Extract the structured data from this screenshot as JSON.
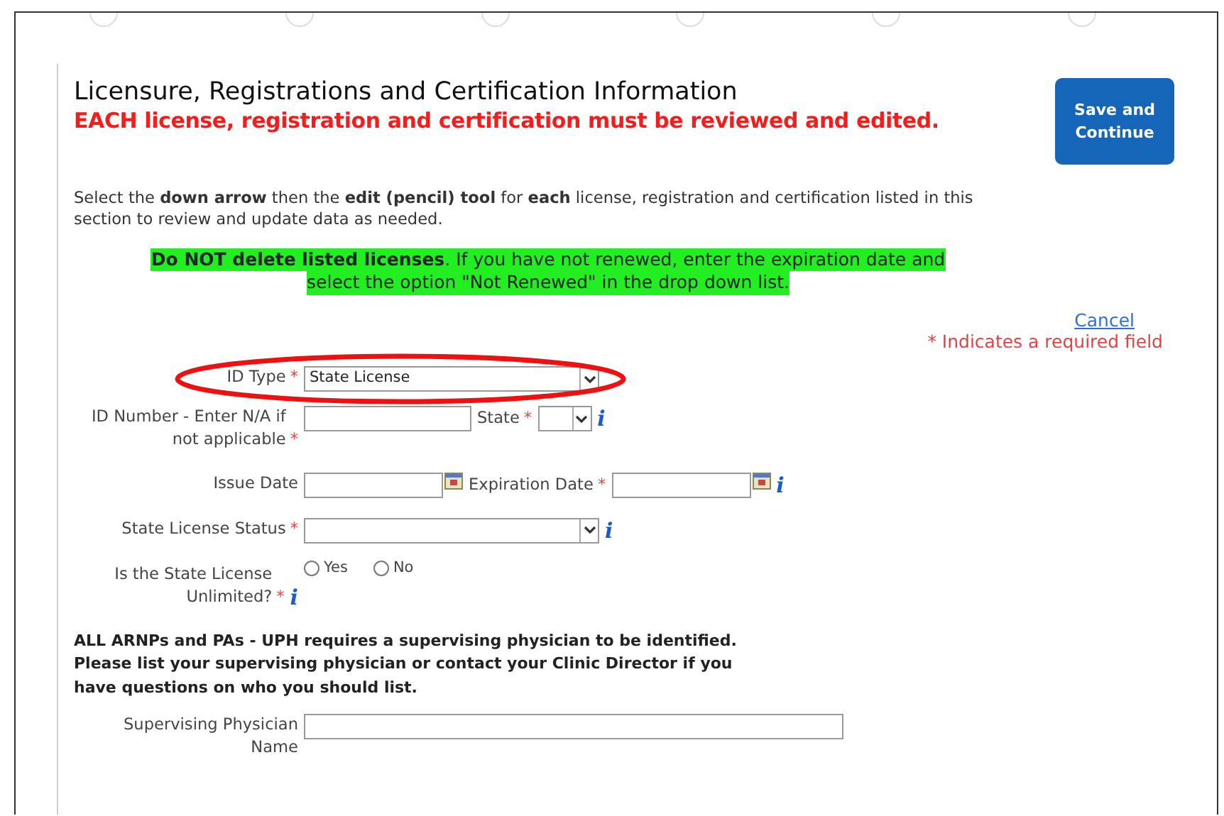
{
  "header": {
    "title": "Licensure, Registrations and Certification Information",
    "warning": "EACH license, registration and certification must be reviewed and edited.",
    "save_button": "Save and Continue"
  },
  "instructions": "Select the **down arrow** then the **edit (pencil) tool** for **each** license, registration and certification listed in this section to review and update data as needed.",
  "notice_lines": [
    "**Do NOT delete listed licenses**.  If you have not renewed, enter the expiration date and",
    "select the option \"Not Renewed\" in the drop down list."
  ],
  "cancel_link": "Cancel",
  "required_note": "* Indicates a required field",
  "rows": [
    {
      "label": "ID Type",
      "required_mark": "*",
      "circled": true,
      "controls": [
        {
          "kind": "select",
          "value": "State License"
        }
      ]
    },
    {
      "label": "ID Number - Enter N/A if not applicable",
      "required_mark": "*",
      "controls": [
        {
          "kind": "text"
        },
        {
          "kind": "label",
          "text": "State",
          "required_mark": "*"
        },
        {
          "kind": "select-short"
        },
        {
          "kind": "info",
          "text": "i"
        }
      ]
    },
    {
      "label": "Issue Date",
      "controls": [
        {
          "kind": "date"
        },
        {
          "kind": "label",
          "text": "Expiration Date",
          "required_mark": "*"
        },
        {
          "kind": "date"
        },
        {
          "kind": "info",
          "text": "i"
        }
      ]
    },
    {
      "label": "State License Status",
      "required_mark": "*",
      "controls": [
        {
          "kind": "select"
        },
        {
          "kind": "info",
          "text": "i"
        }
      ]
    },
    {
      "label": "Is the State License Unlimited?",
      "required_mark": "*",
      "label_info": "i",
      "controls": [
        {
          "kind": "radio",
          "text": "Yes",
          "selected": false
        },
        {
          "kind": "radio",
          "text": "No",
          "selected": false
        }
      ]
    }
  ],
  "physician_note": "ALL ARNPs and PAs - UPH requires a supervising physician to be identified. Please list your supervising physician or contact your Clinic Director if you have questions on who you should list.",
  "physician_row": {
    "label": "Supervising Physician Name",
    "controls": [
      {
        "kind": "text-long"
      }
    ]
  }
}
